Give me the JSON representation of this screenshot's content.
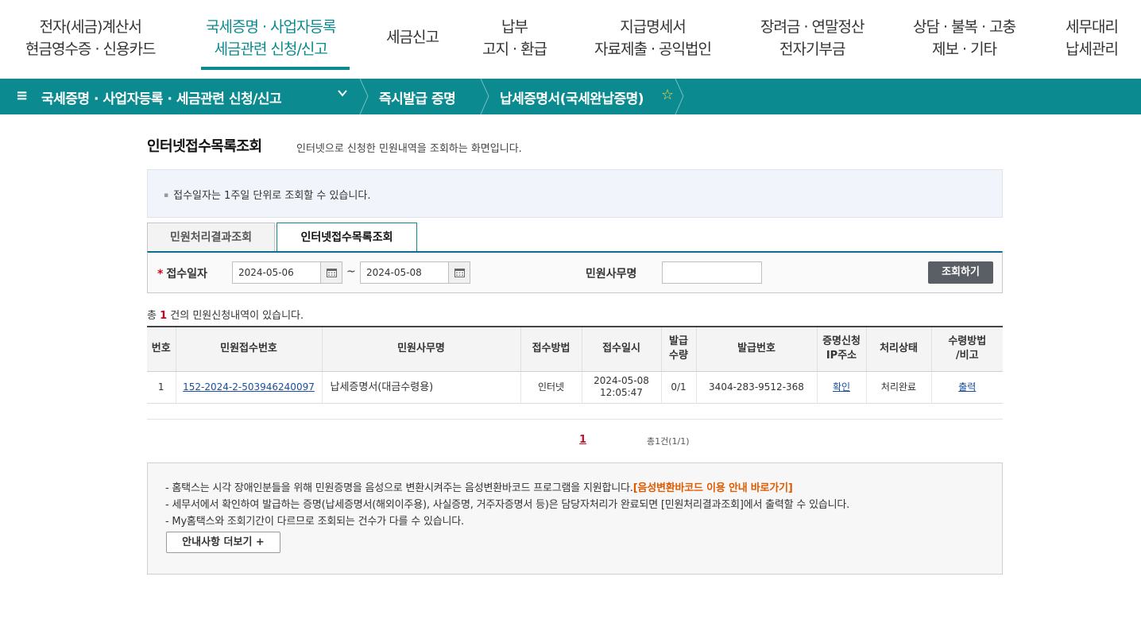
{
  "gnb": {
    "items": [
      {
        "line1": "전자(세금)계산서",
        "line2": "현금영수증 · 신용카드"
      },
      {
        "line1": "국세증명 · 사업자등록",
        "line2": "세금관련 신청/신고"
      },
      {
        "line1": "세금신고",
        "line2": ""
      },
      {
        "line1": "납부",
        "line2": "고지 · 환급"
      },
      {
        "line1": "지급명세서",
        "line2": "자료제출 · 공익법인"
      },
      {
        "line1": "장려금 · 연말정산",
        "line2": "전자기부금"
      },
      {
        "line1": "상담 · 불복 · 고충",
        "line2": "제보 · 기타"
      },
      {
        "line1": "세무대리",
        "line2": "납세관리"
      }
    ],
    "active_index": 1
  },
  "location": {
    "menu_icon": "hamburger-icon",
    "level1": "국세증명 · 사업자등록 · 세금관련 신청/신고",
    "level2": "즉시발급 증명",
    "level3": "납세증명서(국세완납증명)",
    "favorite_icon": "star-icon"
  },
  "page": {
    "title": "인터넷접수목록조회",
    "subtitle": "인터넷으로 신청한 민원내역을 조회하는 화면입니다.",
    "info": "접수일자는 1주일 단위로 조회할 수 있습니다."
  },
  "tabs": [
    {
      "label": "민원처리결과조회",
      "active": false
    },
    {
      "label": "인터넷접수목록조회",
      "active": true
    }
  ],
  "search": {
    "date_label": "접수일자",
    "required_mark": "*",
    "start_date": "2024-05-06",
    "end_date": "2024-05-08",
    "tilde": "~",
    "office_label": "민원사무명",
    "office_value": "",
    "button": "조회하기"
  },
  "result": {
    "prefix": "총 ",
    "count": "1",
    "suffix": " 건의 민원신청내역이 있습니다."
  },
  "table": {
    "headers": [
      "번호",
      "민원접수번호",
      "민원사무명",
      "접수방법",
      "접수일시",
      "발급\n수량",
      "발급번호",
      "증명신청\nIP주소",
      "처리상태",
      "수령방법\n/비고"
    ],
    "rows": [
      {
        "no": "1",
        "receipt_no": "152-2024-2-503946240097",
        "office": "납세증명서(대금수령용)",
        "method": "인터넷",
        "date": "2024-05-08",
        "time": "12:05:47",
        "qty": "0/1",
        "issue_no": "3404-283-9512-368",
        "ip": "확인",
        "status": "처리완료",
        "receive": "출력"
      }
    ]
  },
  "pagination": {
    "current": "1",
    "total": "총1건(1/1)"
  },
  "notice": {
    "line1": "- 홈택스는 시각 장애인분들을 위해 민원증명을 음성으로 변환시켜주는 음성변환바코드 프로그램을 지원합니다.",
    "line1_link": "[음성변환바코드 이용 안내 바로가기]",
    "line2": "- 세무서에서 확인하여 발급하는 증명(납세증명서(해외이주용), 사실증명, 거주자증명서 등)은 담당자처리가 완료되면 [민원처리결과조회]에서 출력할 수 있습니다.",
    "line3": "- My홈택스와 조회기간이 다르므로 조회되는 건수가 다를 수 있습니다.",
    "more_button": "안내사항 더보기 +"
  },
  "colors": {
    "brand": "#0b8a8f",
    "accent_red": "#d0021b",
    "link": "#1a4ea0",
    "notice_highlight": "#e05a00"
  }
}
